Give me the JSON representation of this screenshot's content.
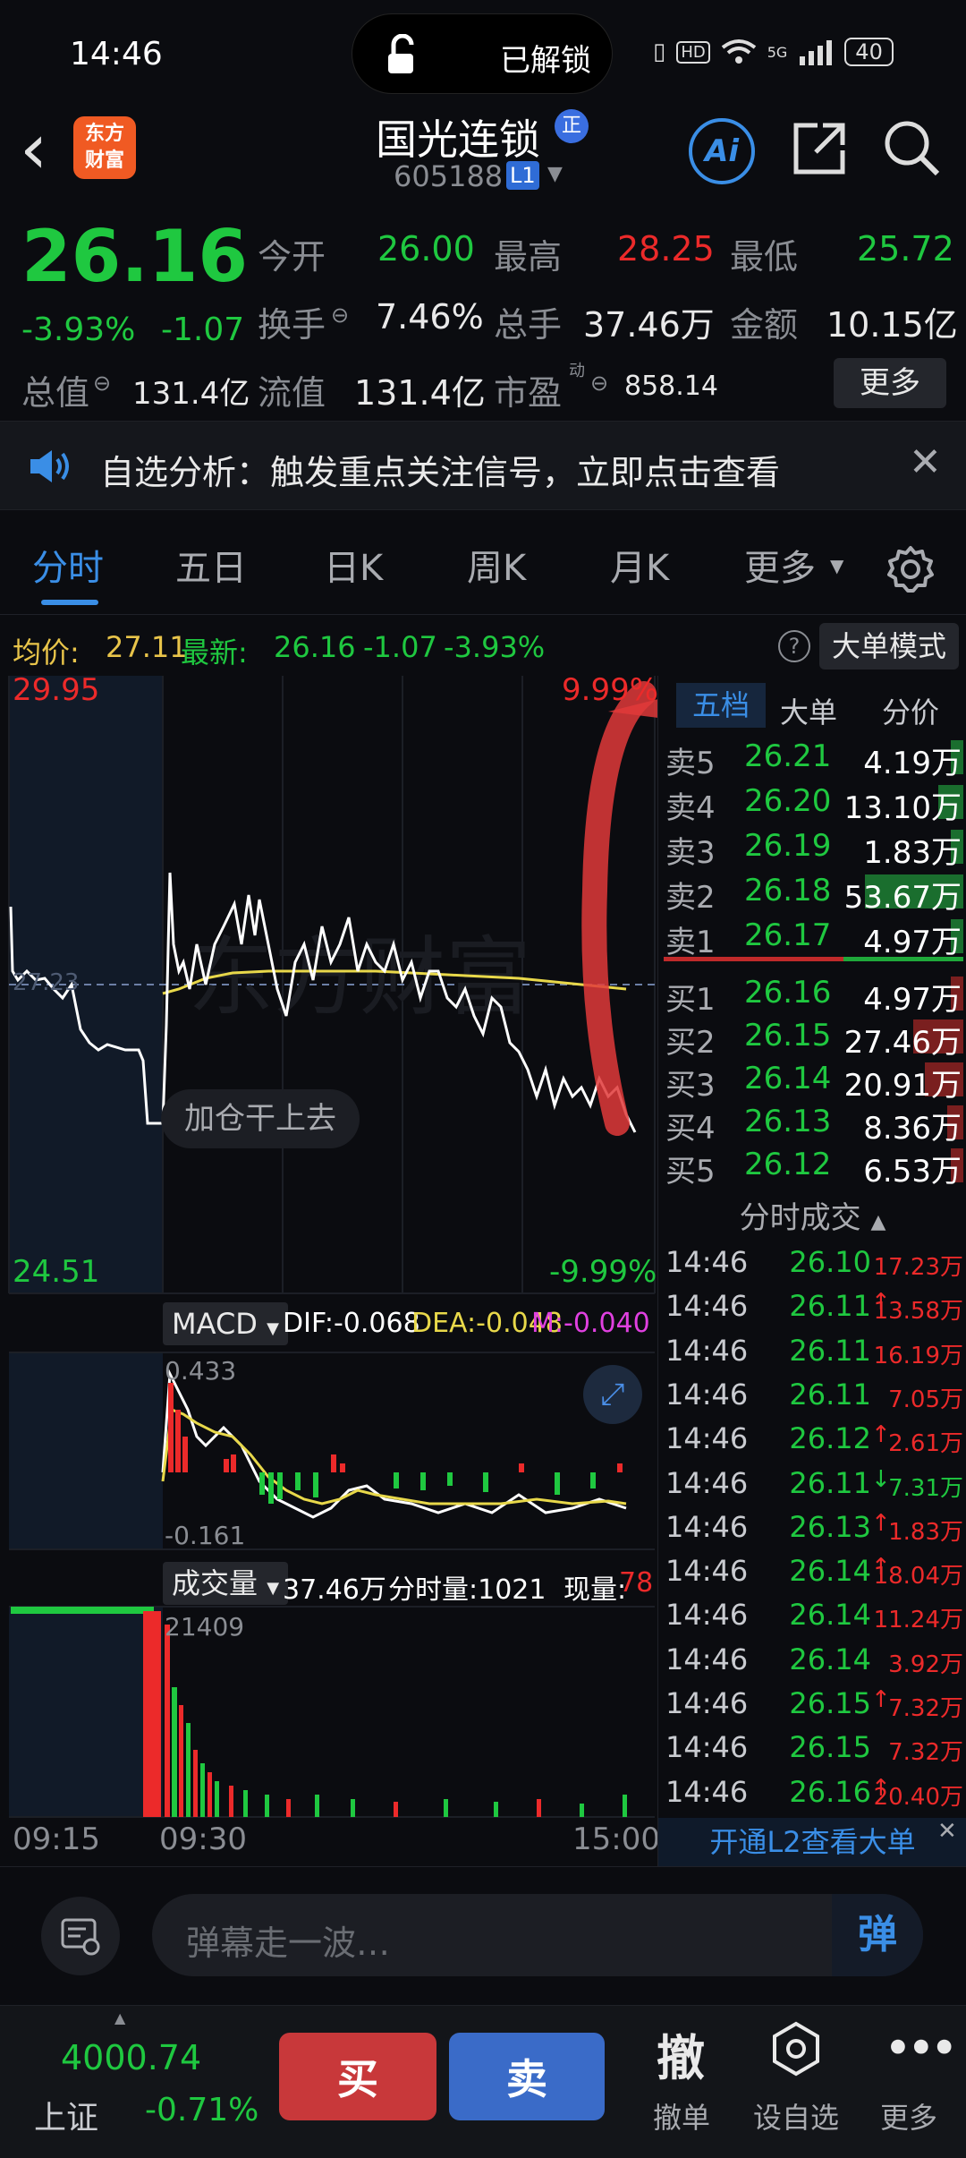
{
  "status": {
    "time": "14:46",
    "lock_text": "已解锁",
    "battery": "40",
    "network": "5G"
  },
  "header": {
    "back": "‹",
    "app_logo": "东方\n财富",
    "stock_name": "国光连锁",
    "name_badge": "正",
    "stock_code": "605188",
    "level_badge": "L1",
    "ai_label": "Ai"
  },
  "quote": {
    "price": "26.16",
    "change_pct": "-3.93%",
    "change": "-1.07",
    "open_label": "今开",
    "open": "26.00",
    "high_label": "最高",
    "high": "28.25",
    "low_label": "最低",
    "low": "25.72",
    "turnover_label": "换手",
    "turnover": "7.46%",
    "volume_label": "总手",
    "volume": "37.46万",
    "amount_label": "金额",
    "amount": "10.15亿",
    "mktcap_label": "总值",
    "mktcap": "131.4亿",
    "float_label": "流值",
    "float": "131.4亿",
    "pe_label": "市盈",
    "pe_sup": "动",
    "pe": "858.14",
    "more": "更多"
  },
  "notice": {
    "text": "自选分析：触发重点关注信号，立即点击查看"
  },
  "tabs": [
    "分时",
    "五日",
    "日K",
    "周K",
    "月K",
    "更多"
  ],
  "infobar": {
    "avg_label": "均价:",
    "avg": "27.11",
    "last_label": "最新:",
    "last": "26.16",
    "chg": "-1.07",
    "chg_pct": "-3.93%",
    "mode_btn": "大单模式"
  },
  "chart": {
    "ymax": "29.95",
    "ymin": "24.51",
    "pmax": "9.99%",
    "pmin": "-9.99%",
    "mid": "27.23",
    "watermark": "东方财富",
    "bubble": "加仓干上去",
    "times": [
      "09:15",
      "09:30",
      "15:00"
    ]
  },
  "macd": {
    "label": "MACD",
    "dif": "DIF:-0.068",
    "dea": "DEA:-0.048",
    "m": "M:-0.040",
    "top": "0.433",
    "bottom": "-0.161"
  },
  "volume": {
    "label": "成交量",
    "total": "37.46万",
    "per_min": "分时量:1021",
    "cur_label": "现量:",
    "cur": "78",
    "max": "21409"
  },
  "orderbook": {
    "tabs": [
      "五档",
      "大单",
      "分价"
    ],
    "asks": [
      {
        "label": "卖5",
        "price": "26.21",
        "vol": "4.19万",
        "bar": 0.08
      },
      {
        "label": "卖4",
        "price": "26.20",
        "vol": "13.10万",
        "bar": 0.25
      },
      {
        "label": "卖3",
        "price": "26.19",
        "vol": "1.83万",
        "bar": 0.04
      },
      {
        "label": "卖2",
        "price": "26.18",
        "vol": "53.67万",
        "bar": 1.0
      },
      {
        "label": "卖1",
        "price": "26.17",
        "vol": "4.97万",
        "bar": 0.09
      }
    ],
    "bids": [
      {
        "label": "买1",
        "price": "26.16",
        "vol": "4.97万",
        "bar": 0.09
      },
      {
        "label": "买2",
        "price": "26.15",
        "vol": "27.46万",
        "bar": 0.51
      },
      {
        "label": "买3",
        "price": "26.14",
        "vol": "20.91万",
        "bar": 0.39
      },
      {
        "label": "买4",
        "price": "26.13",
        "vol": "8.36万",
        "bar": 0.16
      },
      {
        "label": "买5",
        "price": "26.12",
        "vol": "6.53万",
        "bar": 0.12
      }
    ],
    "ticks_title": "分时成交",
    "ticks": [
      {
        "t": "14:46",
        "p": "26.10",
        "a": "",
        "v": "17.23万",
        "c": "r"
      },
      {
        "t": "14:46",
        "p": "26.11",
        "a": "↑",
        "v": "13.58万",
        "c": "r"
      },
      {
        "t": "14:46",
        "p": "26.11",
        "a": "",
        "v": "16.19万",
        "c": "r"
      },
      {
        "t": "14:46",
        "p": "26.11",
        "a": "",
        "v": "7.05万",
        "c": "r"
      },
      {
        "t": "14:46",
        "p": "26.12",
        "a": "↑",
        "v": "2.61万",
        "c": "r"
      },
      {
        "t": "14:46",
        "p": "26.11",
        "a": "↓",
        "v": "7.31万",
        "c": "g"
      },
      {
        "t": "14:46",
        "p": "26.13",
        "a": "↑",
        "v": "1.83万",
        "c": "r"
      },
      {
        "t": "14:46",
        "p": "26.14",
        "a": "↑",
        "v": "18.04万",
        "c": "r"
      },
      {
        "t": "14:46",
        "p": "26.14",
        "a": "",
        "v": "11.24万",
        "c": "r"
      },
      {
        "t": "14:46",
        "p": "26.14",
        "a": "",
        "v": "3.92万",
        "c": "r"
      },
      {
        "t": "14:46",
        "p": "26.15",
        "a": "↑",
        "v": "7.32万",
        "c": "r"
      },
      {
        "t": "14:46",
        "p": "26.15",
        "a": "",
        "v": "7.32万",
        "c": "r"
      },
      {
        "t": "14:46",
        "p": "26.16",
        "a": "↑",
        "v": "20.40万",
        "c": "r"
      }
    ],
    "l2_link": "开通L2查看大单"
  },
  "danmu": {
    "placeholder": "弹幕走一波…",
    "send": "弹"
  },
  "bottom": {
    "index_value": "4000.74",
    "index_name": "上证",
    "index_chg": "-0.71%",
    "buy": "买",
    "sell": "卖",
    "cancel_icon": "撤",
    "cancel": "撤单",
    "watch": "设自选",
    "more": "更多"
  },
  "colors": {
    "up": "#ec2a2a",
    "down": "#1fc840",
    "accent": "#3a8ee6",
    "buy_btn": "#c8383a",
    "sell_btn": "#3a6bc8"
  }
}
